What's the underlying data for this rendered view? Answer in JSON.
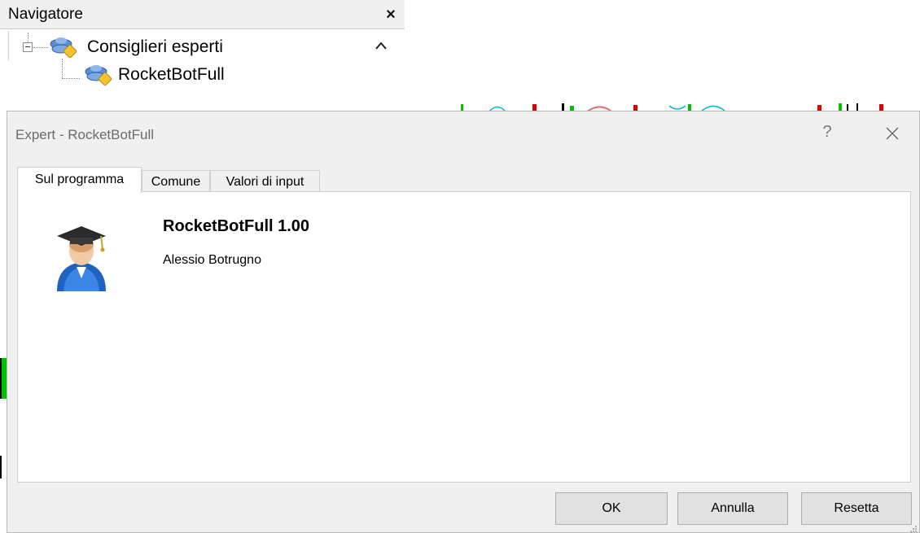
{
  "navigator": {
    "title": "Navigatore",
    "close_label": "×",
    "scroll_up_label": "^",
    "tree": {
      "folder_label": "Consiglieri esperti",
      "items": [
        {
          "label": "RocketBotFull"
        }
      ]
    }
  },
  "dialog": {
    "title": "Expert - RocketBotFull",
    "help_label": "?",
    "tabs": [
      {
        "label": "Sul programma",
        "active": true
      },
      {
        "label": "Comune",
        "active": false
      },
      {
        "label": "Valori di input",
        "active": false
      }
    ],
    "about": {
      "name_version": "RocketBotFull 1.00",
      "author": "Alessio Botrugno"
    },
    "buttons": {
      "ok": "OK",
      "cancel": "Annulla",
      "reset": "Resetta"
    }
  },
  "colors": {
    "dialog_bg": "#f0f0f0",
    "panel_bg": "#ffffff",
    "button_bg": "#e1e1e1",
    "chart_green": "#00c000",
    "chart_red": "#e00000",
    "chart_cyan": "#00bcd4"
  }
}
